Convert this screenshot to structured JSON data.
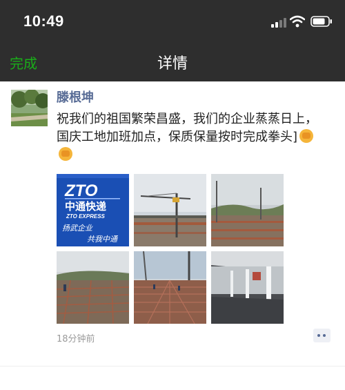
{
  "status_bar": {
    "time": "10:49",
    "icons": [
      "signal-icon",
      "wifi-icon",
      "battery-icon"
    ]
  },
  "nav": {
    "done_label": "完成",
    "title": "详情"
  },
  "post": {
    "author": "滕根坤",
    "text": "祝我们的祖国繁荣昌盛，我们的企业蒸蒸日上，国庆工地加班加点，保质保量按时完成拳头]",
    "emojis": [
      "fist-emoji",
      "fist-emoji"
    ],
    "photos": [
      {
        "name": "zto-logo-photo",
        "brand": "ZTO",
        "brand_cn": "中通快递",
        "brand_en": "ZTO EXPRESS",
        "slogan_1": "扬武企业",
        "slogan_2": "共我中通"
      },
      {
        "name": "tower-crane-photo"
      },
      {
        "name": "site-overview-photo"
      },
      {
        "name": "rebar-workers-photo"
      },
      {
        "name": "rebar-grid-photo"
      },
      {
        "name": "warehouse-interior-photo"
      }
    ],
    "timestamp": "18分钟前"
  },
  "colors": {
    "header_bg": "#2e2e2e",
    "accent_green": "#1aad19",
    "name_blue": "#576b95",
    "zto_blue": "#1a4fb4"
  }
}
